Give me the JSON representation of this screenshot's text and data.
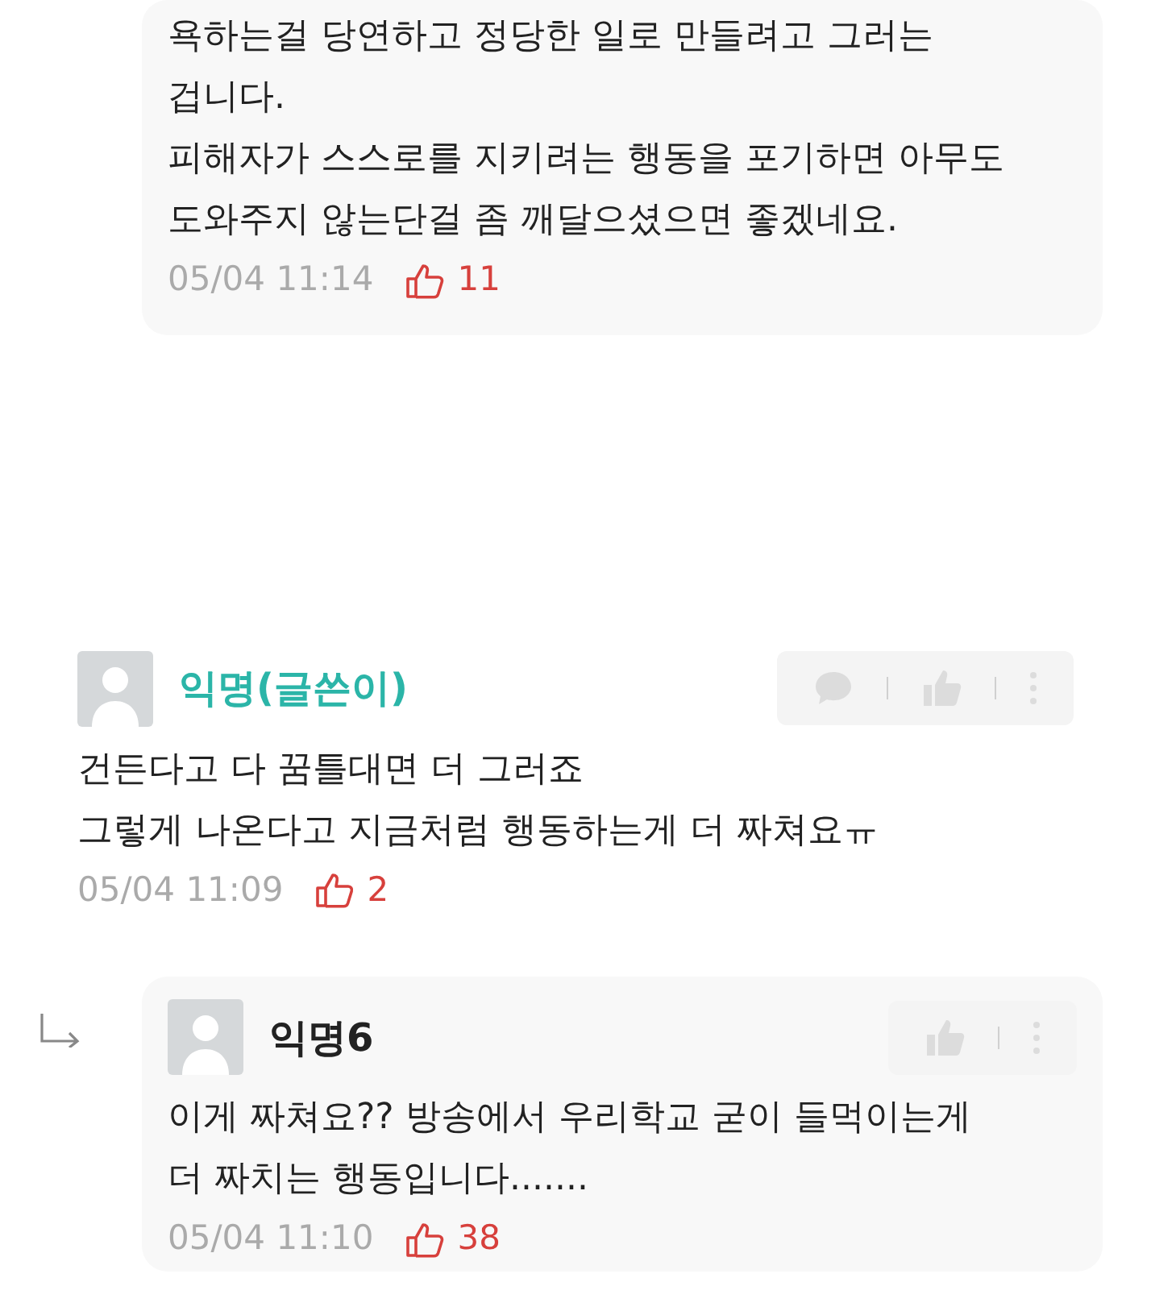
{
  "comments": [
    {
      "kind": "reply",
      "lines": [
        "욕하는걸 당연하고 정당한 일로 만들려고 그러는",
        "겁니다.",
        "피해자가 스스로를 지키려는 행동을 포기하면 아무도",
        "도와주지 않는단걸 좀 깨달으셨으면 좋겠네요."
      ],
      "time": "05/04 11:14",
      "likes": "11"
    },
    {
      "kind": "comment",
      "author": "익명(글쓴이)",
      "is_writer": true,
      "actions": [
        {
          "kind": "chat"
        },
        {
          "kind": "like"
        },
        {
          "kind": "more"
        }
      ],
      "lines": [
        "건든다고 다 꿈틀대면 더 그러죠",
        "그렇게 나온다고 지금처럼 행동하는게 더 짜쳐요ㅠ"
      ],
      "time": "05/04 11:09",
      "likes": "2"
    },
    {
      "kind": "reply",
      "author": "익명6",
      "is_writer": false,
      "actions": [
        {
          "kind": "like"
        },
        {
          "kind": "more"
        }
      ],
      "lines": [
        "이게 짜쳐요?? 방송에서 우리학교 굳이 들먹이는게",
        "더 짜치는 행동입니다......."
      ],
      "time": "05/04 11:10",
      "likes": "38"
    }
  ]
}
